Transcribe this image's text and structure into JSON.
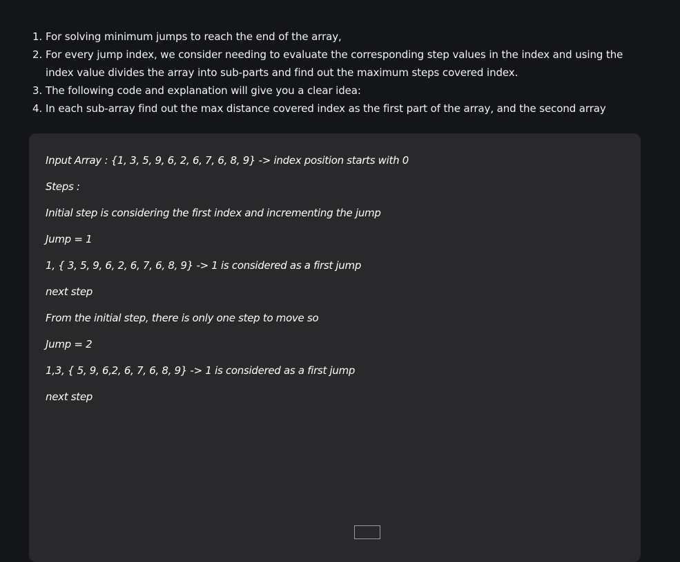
{
  "steps": [
    {
      "number": "1.",
      "text": "For solving minimum jumps to reach the end of the array,"
    },
    {
      "number": "2.",
      "text": "For every jump index, we consider needing to evaluate the corresponding step values in the index and using the index value divides the array into sub-parts and find out the maximum steps covered index."
    },
    {
      "number": "3.",
      "text": "The following code and explanation will give you a clear idea:"
    },
    {
      "number": "4.",
      "text": "In each sub-array find out the max distance covered index as the first part of the array, and the second array"
    }
  ],
  "explanation": {
    "lines": [
      "Input Array : {1, 3, 5, 9, 6, 2, 6, 7, 6, 8, 9} -> index position starts with 0",
      "Steps :",
      "Initial step is considering the first index and incrementing the jump",
      "Jump = 1",
      "1, { 3, 5, 9, 6, 2, 6, 7, 6, 8, 9} -> 1 is considered as a first jump",
      "next step",
      "From the initial step, there is only one step to move so",
      "Jump = 2",
      "1,3, { 5, 9, 6,2, 6, 7, 6, 8, 9} -> 1 is considered as a first jump",
      "next step"
    ]
  }
}
